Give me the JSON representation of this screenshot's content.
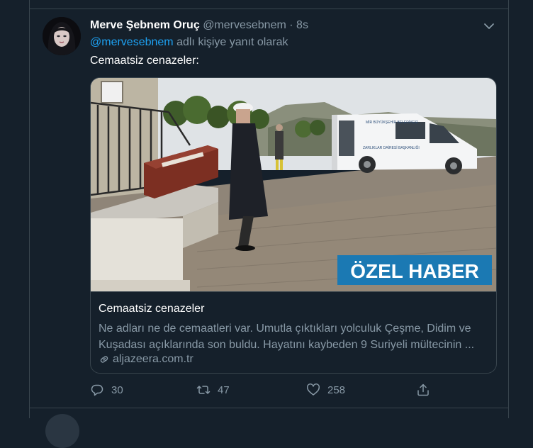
{
  "tweet": {
    "display_name": "Merve Şebnem Oruç",
    "handle": "@mervesebnem",
    "separator": "·",
    "time": "8s",
    "reply_mention": "@mervesebnem",
    "reply_suffix": " adlı kişiye yanıt olarak",
    "text": "Cemaatsiz cenazeler:"
  },
  "card": {
    "image_badge": "ÖZEL HABER",
    "van_text_1": "MİR BÜYÜKŞEHİR BELEDİYESİ",
    "van_text_2": "ZARLIKLAR DAİRESİ BAŞKANLIĞI",
    "title": "Cemaatsiz cenazeler",
    "description": "Ne adları ne de cemaatleri var. Umutla çıktıkları yolculuk Çeşme, Didim ve Kuşadası açıklarında son buldu. Hayatını kaybeden 9 Suriyeli mültecinin ...",
    "domain": "aljazeera.com.tr"
  },
  "actions": {
    "replies": "30",
    "retweets": "47",
    "likes": "258"
  },
  "colors": {
    "background": "#15202b",
    "border": "#38444d",
    "secondary_text": "#8899a6",
    "link": "#1da1f2",
    "badge_bg": "#1b79b3"
  }
}
